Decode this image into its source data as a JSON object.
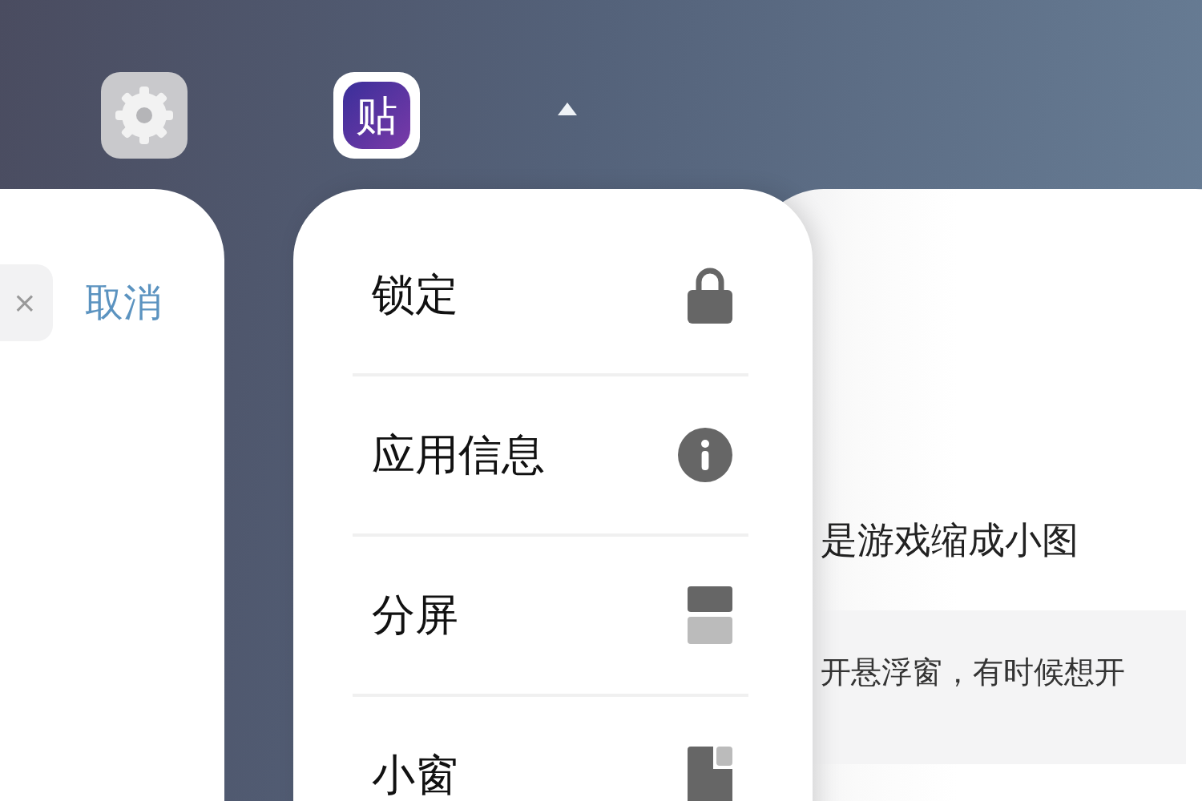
{
  "app_icons": [
    {
      "kind": "gear"
    },
    {
      "kind": "letter",
      "glyph": "贴"
    }
  ],
  "left_card": {
    "clear": "×",
    "cancel": "取消"
  },
  "menu": {
    "items": [
      {
        "label": "锁定",
        "kind": "lock"
      },
      {
        "label": "应用信息",
        "kind": "info"
      },
      {
        "label": "分屏",
        "kind": "split"
      },
      {
        "label": "小窗",
        "kind": "window"
      }
    ]
  },
  "right_card": {
    "heading": "是游戏缩成小图",
    "quote": "开悬浮窗，有时候想开"
  }
}
